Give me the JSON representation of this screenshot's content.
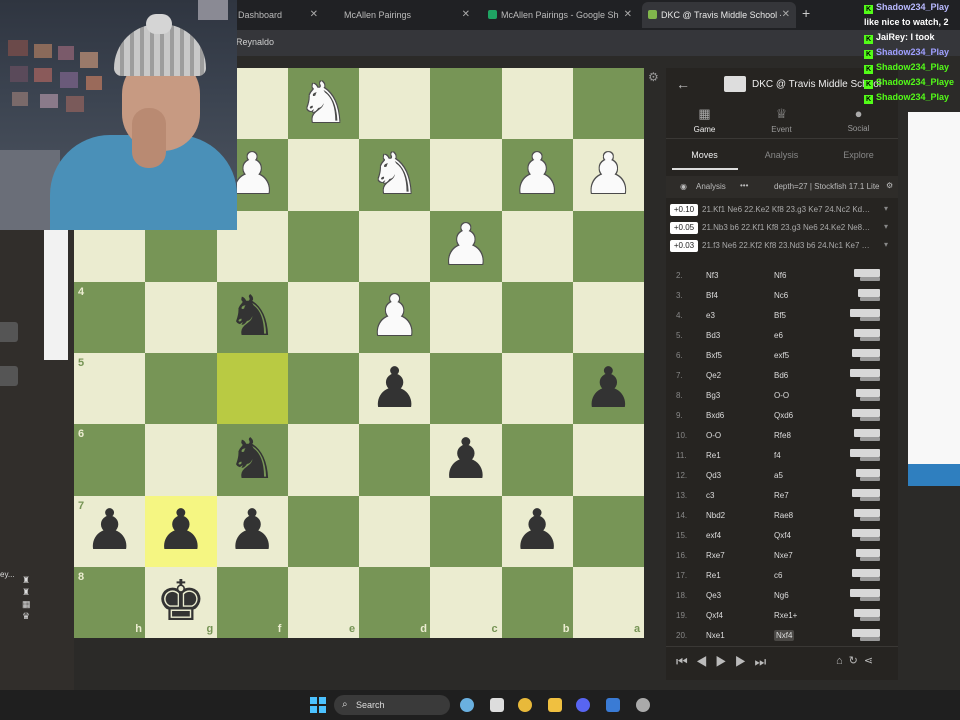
{
  "browser": {
    "tabs": [
      {
        "label": "Dashboard",
        "active": false
      },
      {
        "label": "McAllen Pairings",
        "active": false
      },
      {
        "label": "McAllen Pairings - Google Sheets",
        "active": false
      },
      {
        "label": "DKC @ Travis Middle School -",
        "active": true
      }
    ],
    "url_text": "a_Reynaldo"
  },
  "board": {
    "files_bottom": [
      "h",
      "g",
      "f",
      "e",
      "d",
      "c",
      "b",
      "a"
    ],
    "ranks_left": [
      "4",
      "5",
      "6",
      "7",
      "8"
    ],
    "colors": {
      "light": "#ebecd0",
      "dark": "#779556",
      "highlight_dark": "#b9ca43",
      "highlight_light": "#f5f682"
    }
  },
  "panel": {
    "title": "DKC @ Travis Middle School",
    "main_tabs": [
      "Game",
      "Event",
      "Social"
    ],
    "sub_tabs": [
      "Moves",
      "Analysis",
      "Explore"
    ],
    "engine": {
      "name": "Analysis",
      "depth": "depth=27 | Stockfish 17.1 Lite"
    },
    "lines": [
      {
        "eval": "+0.10",
        "text": "21.Kf1 Ne6 22.Ke2 Kf8 23.g3 Ke7 24.Nc2 Kd…"
      },
      {
        "eval": "+0.05",
        "text": "21.Nb3 b6 22.Kf1 Kf8 23.g3 Ne6 24.Ke2 Ne8…"
      },
      {
        "eval": "+0.03",
        "text": "21.f3 Ne6 22.Kf2 Kf8 23.Nd3 b6 24.Nc1 Ke7 …"
      }
    ],
    "moves": [
      {
        "n": "2.",
        "w": "Nf3",
        "b": "Nf6"
      },
      {
        "n": "3.",
        "w": "Bf4",
        "b": "Nc6"
      },
      {
        "n": "4.",
        "w": "e3",
        "b": "Bf5"
      },
      {
        "n": "5.",
        "w": "Bd3",
        "b": "e6"
      },
      {
        "n": "6.",
        "w": "Bxf5",
        "b": "exf5"
      },
      {
        "n": "7.",
        "w": "Qe2",
        "b": "Bd6"
      },
      {
        "n": "8.",
        "w": "Bg3",
        "b": "O-O"
      },
      {
        "n": "9.",
        "w": "Bxd6",
        "b": "Qxd6"
      },
      {
        "n": "10.",
        "w": "O-O",
        "b": "Rfe8"
      },
      {
        "n": "11.",
        "w": "Re1",
        "b": "f4"
      },
      {
        "n": "12.",
        "w": "Qd3",
        "b": "a5"
      },
      {
        "n": "13.",
        "w": "c3",
        "b": "Re7"
      },
      {
        "n": "14.",
        "w": "Nbd2",
        "b": "Rae8"
      },
      {
        "n": "15.",
        "w": "exf4",
        "b": "Qxf4"
      },
      {
        "n": "16.",
        "w": "Rxe7",
        "b": "Nxe7"
      },
      {
        "n": "17.",
        "w": "Re1",
        "b": "c6"
      },
      {
        "n": "18.",
        "w": "Qe3",
        "b": "Ng6"
      },
      {
        "n": "19.",
        "w": "Qxf4",
        "b": "Rxe1+"
      },
      {
        "n": "20.",
        "w": "Nxe1",
        "b": "Nxf4"
      }
    ]
  },
  "chat": [
    {
      "user": "Shadow234_Play",
      "text": "",
      "color": "#b9b9ff"
    },
    {
      "user": "",
      "text": "like nice to watch, 2",
      "color": "#ffffff"
    },
    {
      "user": "JaiRey",
      "text": ": I took",
      "color": "#ffffff"
    },
    {
      "user": "Shadow234_Play",
      "text": "",
      "color": "#9f9fff"
    },
    {
      "user": "Shadow234_Play",
      "text": "",
      "color": "#53fc18"
    },
    {
      "user": "Shadow234_Playe",
      "text": "",
      "color": "#53fc18"
    },
    {
      "user": "Shadow234_Play",
      "text": "",
      "color": "#53fc18"
    }
  ],
  "sidebar": {
    "player_label": "ey..."
  },
  "taskbar": {
    "search_label": "Search"
  }
}
